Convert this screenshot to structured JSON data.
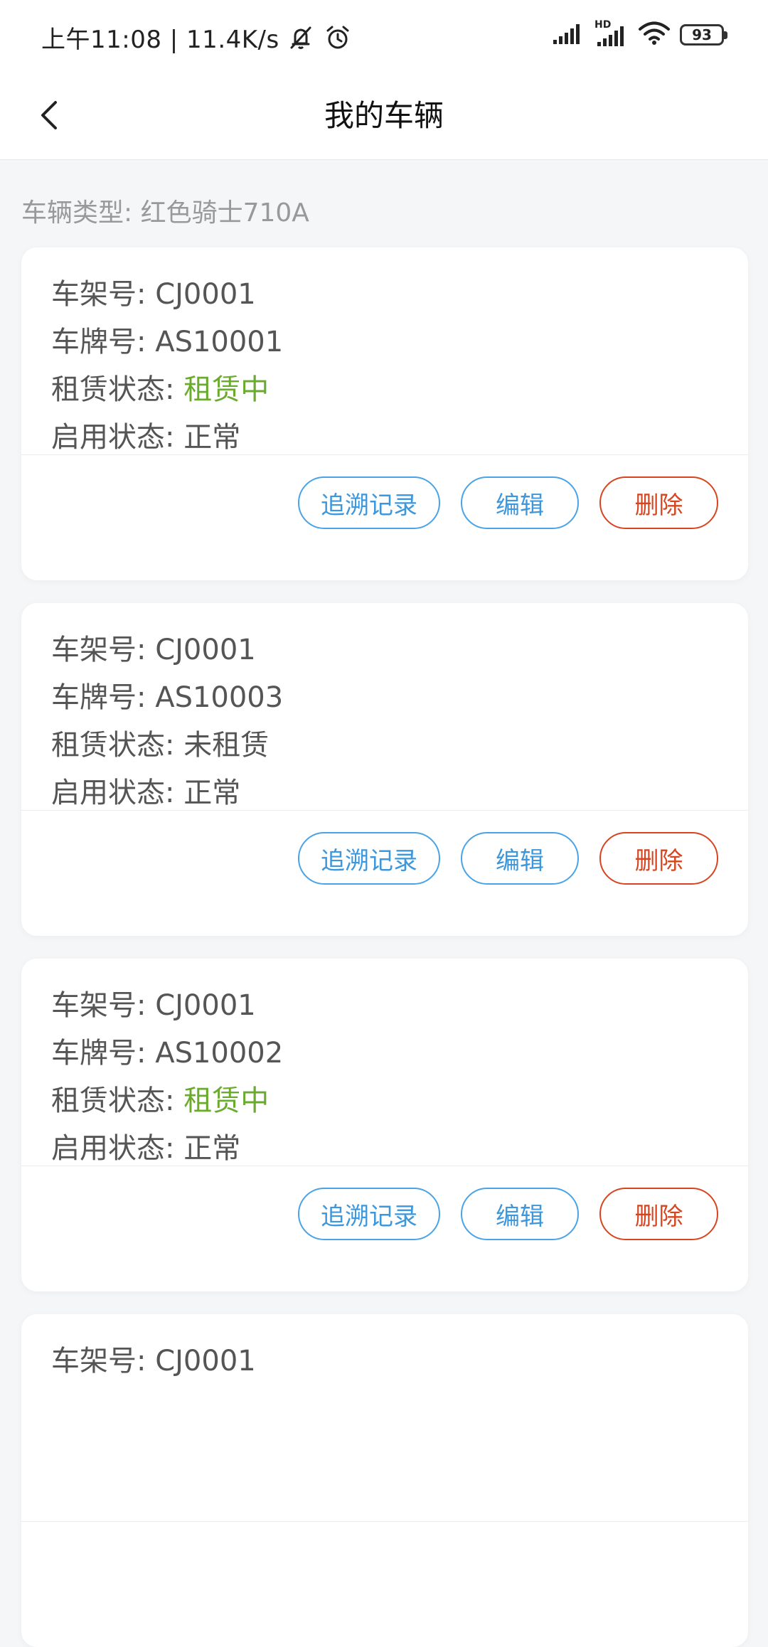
{
  "status_bar": {
    "time_speed": "上午11:08 | 11.4K/s",
    "hd_label": "HD",
    "battery": "93"
  },
  "header": {
    "title": "我的车辆"
  },
  "vehicle_type": {
    "label": "车辆类型:",
    "value": "红色骑士710A"
  },
  "labels": {
    "frame": "车架号:",
    "plate": "车牌号:",
    "rent_status": "租赁状态:",
    "enable_status": "启用状态:"
  },
  "buttons": {
    "trace": "追溯记录",
    "edit": "编辑",
    "delete": "删除"
  },
  "colors": {
    "renting": "#6aab2e",
    "primary": "#3d97dc",
    "danger": "#d6451f"
  },
  "vehicles": [
    {
      "frame": "CJ0001",
      "plate": "AS10001",
      "rent_status": "租赁中",
      "enable_status": "正常"
    },
    {
      "frame": "CJ0001",
      "plate": "AS10003",
      "rent_status": "未租赁",
      "enable_status": "正常"
    },
    {
      "frame": "CJ0001",
      "plate": "AS10002",
      "rent_status": "租赁中",
      "enable_status": "正常"
    },
    {
      "frame": "CJ0001"
    }
  ]
}
